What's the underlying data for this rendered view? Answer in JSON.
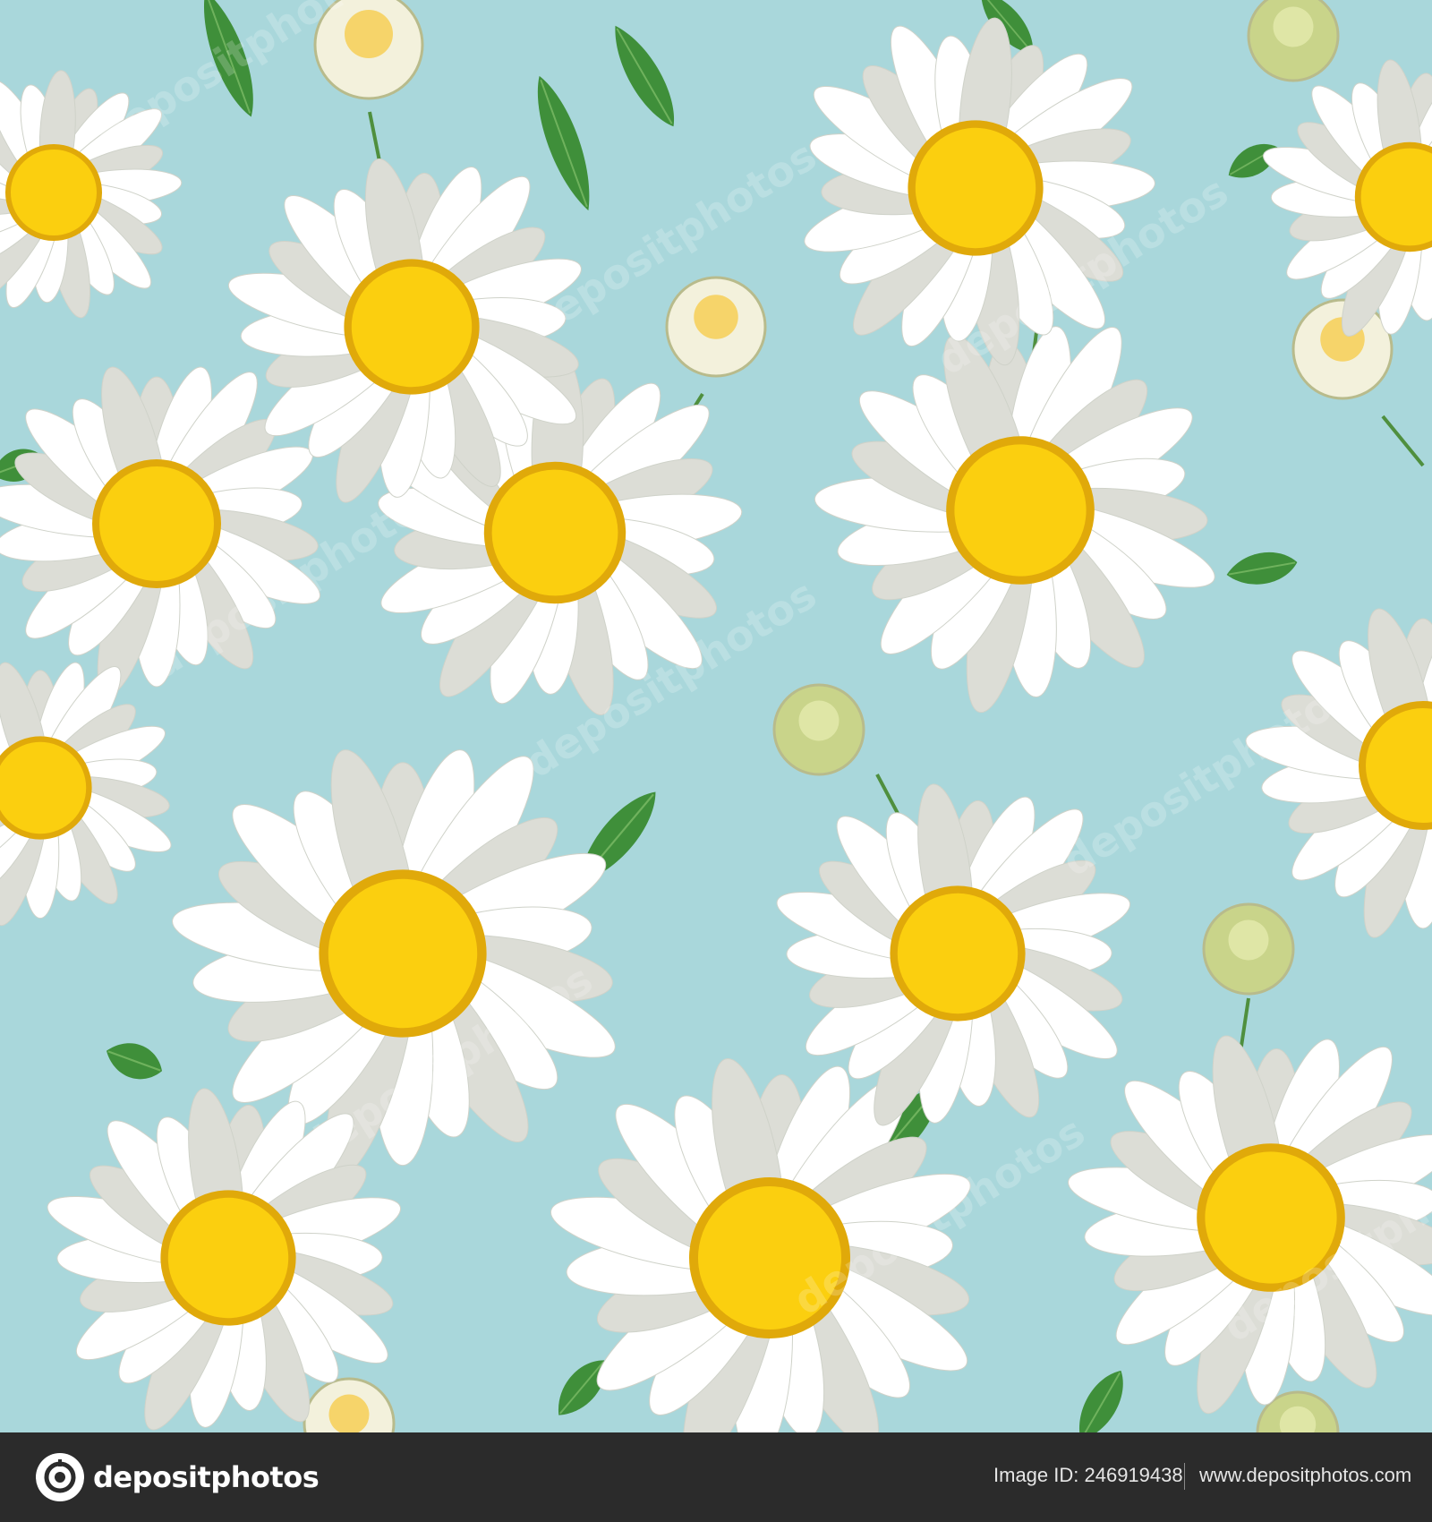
{
  "colors": {
    "background": "#a9d7db",
    "petal": "#ffffff",
    "petal_shade": "#dcddd6",
    "center": "#fbcf0f",
    "center_edge": "#e0a90a",
    "leaf": "#3f8f3a",
    "leaf_light": "#6fb25d",
    "bud": "#c9d48a",
    "footer": "#2b2b2b"
  },
  "watermark": {
    "text": "depositphotos"
  },
  "footer": {
    "logo": {
      "icon": "camera-aperture-icon",
      "text": "depositphotos"
    },
    "image_id": "Image ID: 246919438",
    "site": "www.depositphotos.com"
  }
}
